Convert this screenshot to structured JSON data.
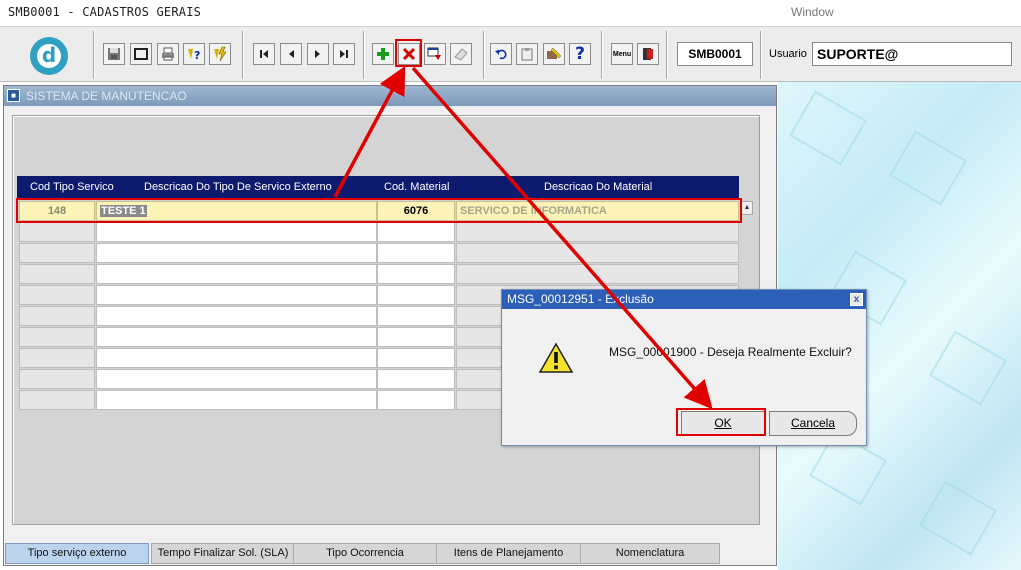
{
  "menubar": {
    "title": "SMB0001 - CADASTROS GERAIS",
    "window_menu": "Window"
  },
  "toolbar": {
    "form_code": "SMB0001",
    "usuario_label": "Usuario",
    "usuario_value": "SUPORTE@",
    "logo_letter": "d",
    "buttons": {
      "save": "save-icon",
      "print": "print-icon",
      "query": "query-icon",
      "first": "first-record-icon",
      "prev": "prev-record-icon",
      "next": "next-record-icon",
      "last": "last-record-icon",
      "insert": "insert-record-icon",
      "delete": "delete-record-icon",
      "undo": "undo-icon",
      "help": "help-icon",
      "menu": "menu-icon",
      "exit": "exit-icon"
    },
    "help_glyph": "?",
    "menu_glyph": "Menu"
  },
  "form": {
    "title": "SISTEMA DE MANUTENCAO",
    "columns": [
      "Cod Tipo Servico",
      "Descricao Do Tipo De Servico Externo",
      "Cod. Material",
      "Descricao Do Material"
    ],
    "rows": [
      {
        "cod_tipo": "148",
        "descricao": "TESTE 1",
        "cod_material": "6076",
        "desc_material": "SERVICO DE INFORMATICA"
      }
    ],
    "empty_row_count": 9
  },
  "tabs": [
    "Tipo serviço externo",
    "Tempo Finalizar Sol. (SLA)",
    "Tipo Ocorrencia",
    "Itens de Planejamento",
    "Nomenclatura"
  ],
  "dialog": {
    "title": "MSG_00012951 - Exclusão",
    "message": "MSG_00001900 - Deseja Realmente Excluir?",
    "ok_label": "OK",
    "cancel_label": "Cancela",
    "close_glyph": "x"
  },
  "colors": {
    "highlight": "#e00000",
    "grid_header": "#0e1a6e",
    "selected_row": "#fbf3b8",
    "dialog_title": "#2c5fb8"
  }
}
